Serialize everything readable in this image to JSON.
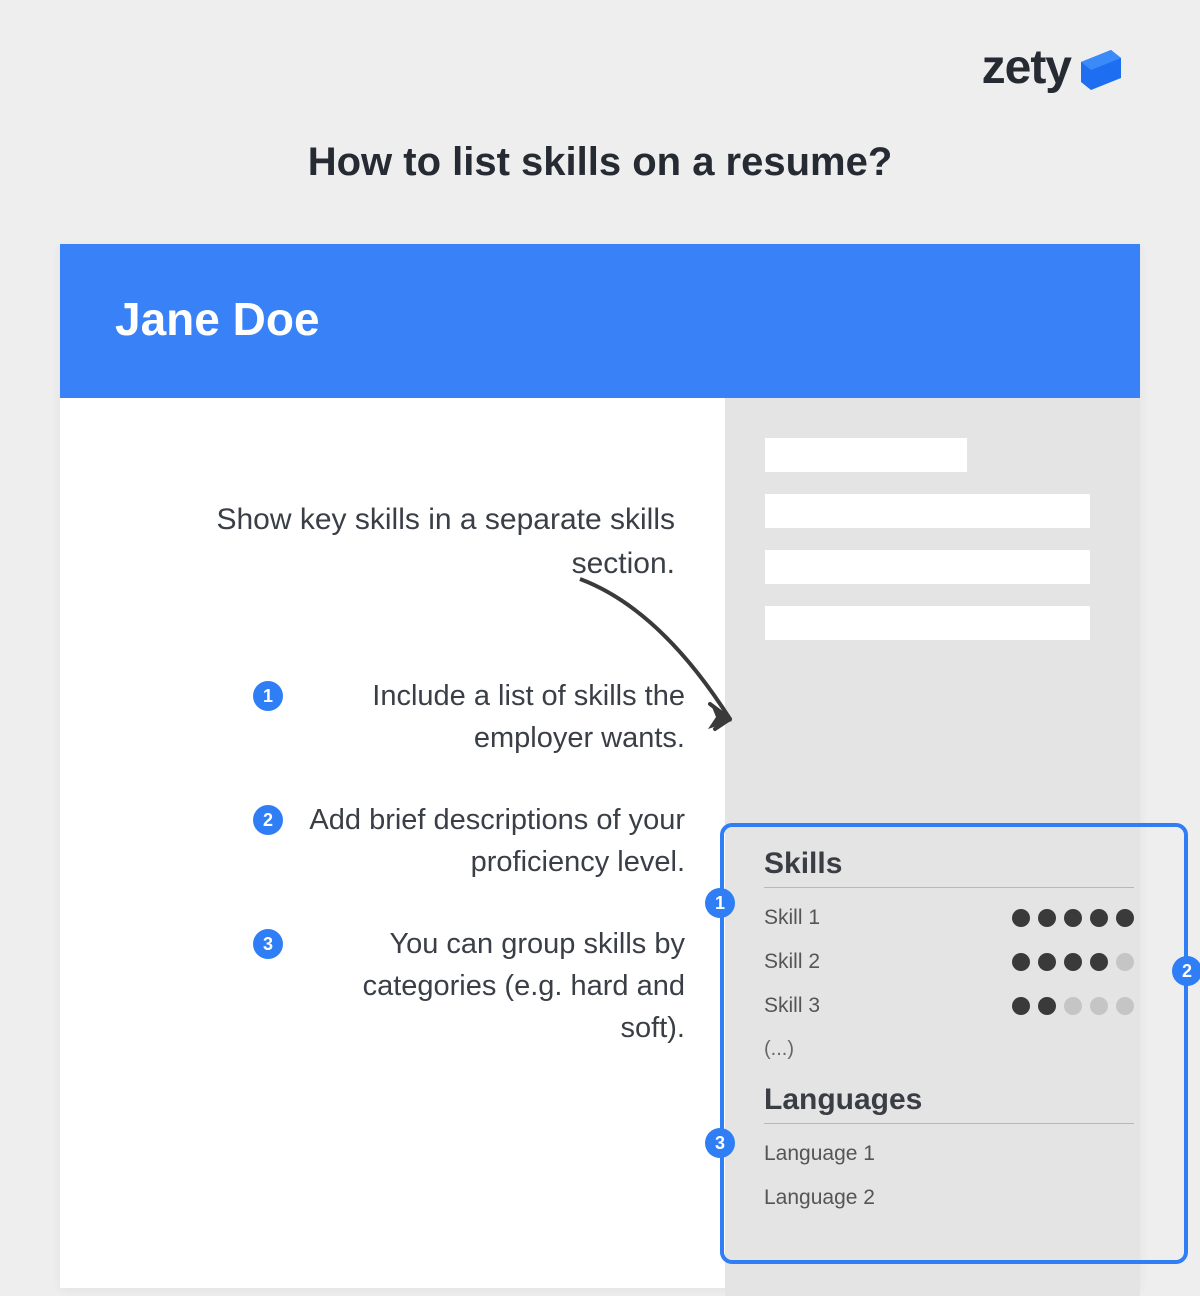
{
  "logo": {
    "text": "zety"
  },
  "title": "How to list skills on a resume?",
  "resume": {
    "name": "Jane Doe",
    "intro": "Show key skills in a separate skills section.",
    "tips": [
      {
        "num": "1",
        "text": "Include a list of skills the employer wants."
      },
      {
        "num": "2",
        "text": "Add brief descriptions of your proficiency level."
      },
      {
        "num": "3",
        "text": "You can group skills by categories (e.g. hard and soft)."
      }
    ],
    "skills_heading": "Skills",
    "skills": [
      {
        "name": "Skill 1",
        "level": 5
      },
      {
        "name": "Skill 2",
        "level": 4
      },
      {
        "name": "Skill 3",
        "level": 2
      }
    ],
    "ellipsis": "(...)",
    "languages_heading": "Languages",
    "languages": [
      "Language 1",
      "Language 2"
    ],
    "badges": [
      "1",
      "2",
      "3"
    ]
  }
}
